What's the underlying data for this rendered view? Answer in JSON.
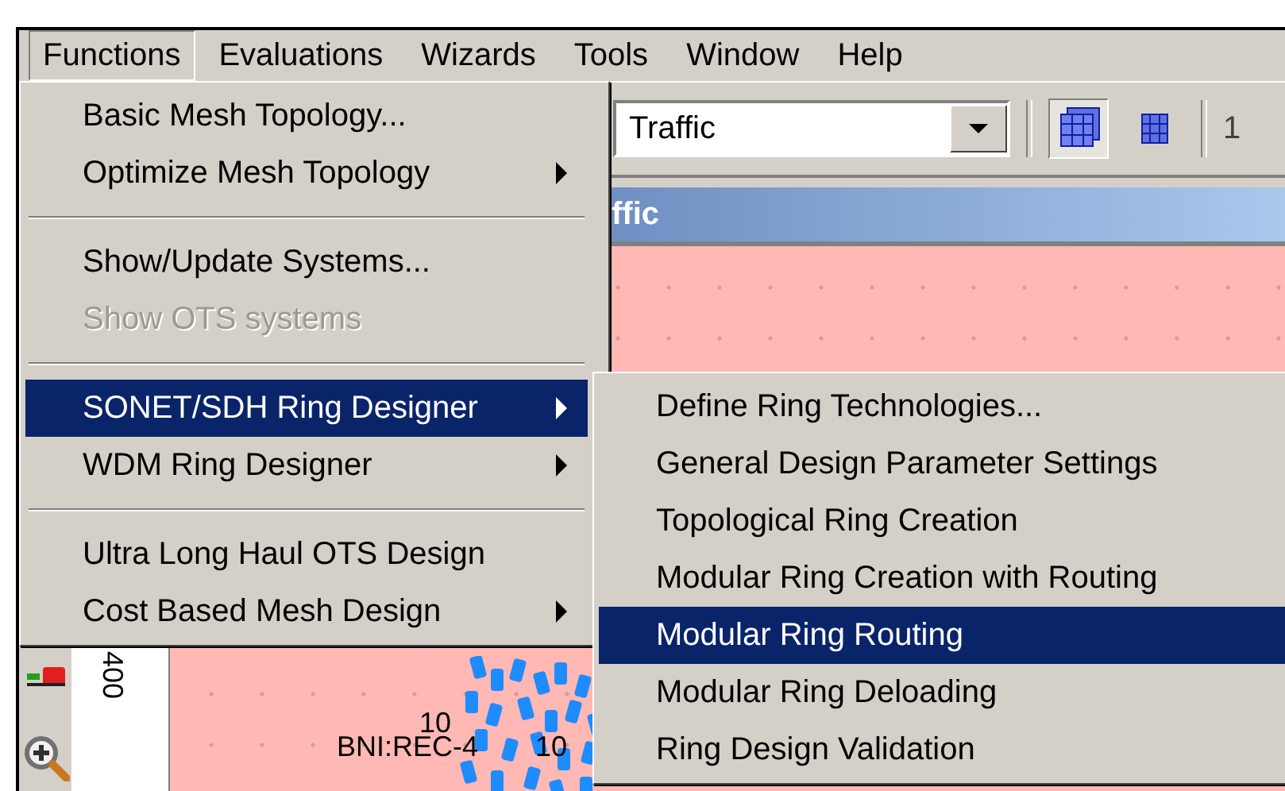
{
  "menubar": [
    {
      "label": "Functions",
      "selected": true
    },
    {
      "label": "Evaluations",
      "selected": false
    },
    {
      "label": "Wizards",
      "selected": false
    },
    {
      "label": "Tools",
      "selected": false
    },
    {
      "label": "Window",
      "selected": false
    },
    {
      "label": "Help",
      "selected": false
    }
  ],
  "toolbar": {
    "combo_value": "Traffic",
    "buttons": [
      {
        "kind": "cube",
        "selected": true
      },
      {
        "kind": "grid",
        "selected": false
      }
    ],
    "cut_text": "1"
  },
  "document_title": "ffic",
  "canvas": {
    "axis_label": "400",
    "labels": [
      {
        "text": "10"
      },
      {
        "text": "BNI:REC-4"
      },
      {
        "text": "10"
      }
    ]
  },
  "menu": [
    {
      "kind": "item",
      "label": "Basic Mesh Topology...",
      "submenu": false,
      "disabled": false,
      "selected": false
    },
    {
      "kind": "item",
      "label": "Optimize Mesh Topology",
      "submenu": true,
      "disabled": false,
      "selected": false
    },
    {
      "kind": "separator"
    },
    {
      "kind": "item",
      "label": "Show/Update Systems...",
      "submenu": false,
      "disabled": false,
      "selected": false
    },
    {
      "kind": "item",
      "label": "Show OTS systems",
      "submenu": false,
      "disabled": true,
      "selected": false
    },
    {
      "kind": "separator"
    },
    {
      "kind": "item",
      "label": "SONET/SDH Ring Designer",
      "submenu": true,
      "disabled": false,
      "selected": true
    },
    {
      "kind": "item",
      "label": "WDM Ring Designer",
      "submenu": true,
      "disabled": false,
      "selected": false
    },
    {
      "kind": "separator"
    },
    {
      "kind": "item",
      "label": "Ultra Long Haul OTS Design",
      "submenu": false,
      "disabled": false,
      "selected": false
    },
    {
      "kind": "item",
      "label": "Cost Based Mesh Design",
      "submenu": true,
      "disabled": false,
      "selected": false
    }
  ],
  "submenu": [
    {
      "kind": "item",
      "label": "Define Ring Technologies...",
      "disabled": false,
      "selected": false
    },
    {
      "kind": "item",
      "label": "General Design Parameter Settings",
      "disabled": false,
      "selected": false
    },
    {
      "kind": "item",
      "label": "Topological Ring Creation",
      "disabled": false,
      "selected": false
    },
    {
      "kind": "item",
      "label": "Modular Ring Creation with Routing",
      "disabled": false,
      "selected": false
    },
    {
      "kind": "item",
      "label": "Modular Ring Routing",
      "disabled": false,
      "selected": true
    },
    {
      "kind": "item",
      "label": "Modular Ring Deloading",
      "disabled": false,
      "selected": false
    },
    {
      "kind": "item",
      "label": "Ring Design Validation",
      "disabled": false,
      "selected": false
    }
  ]
}
